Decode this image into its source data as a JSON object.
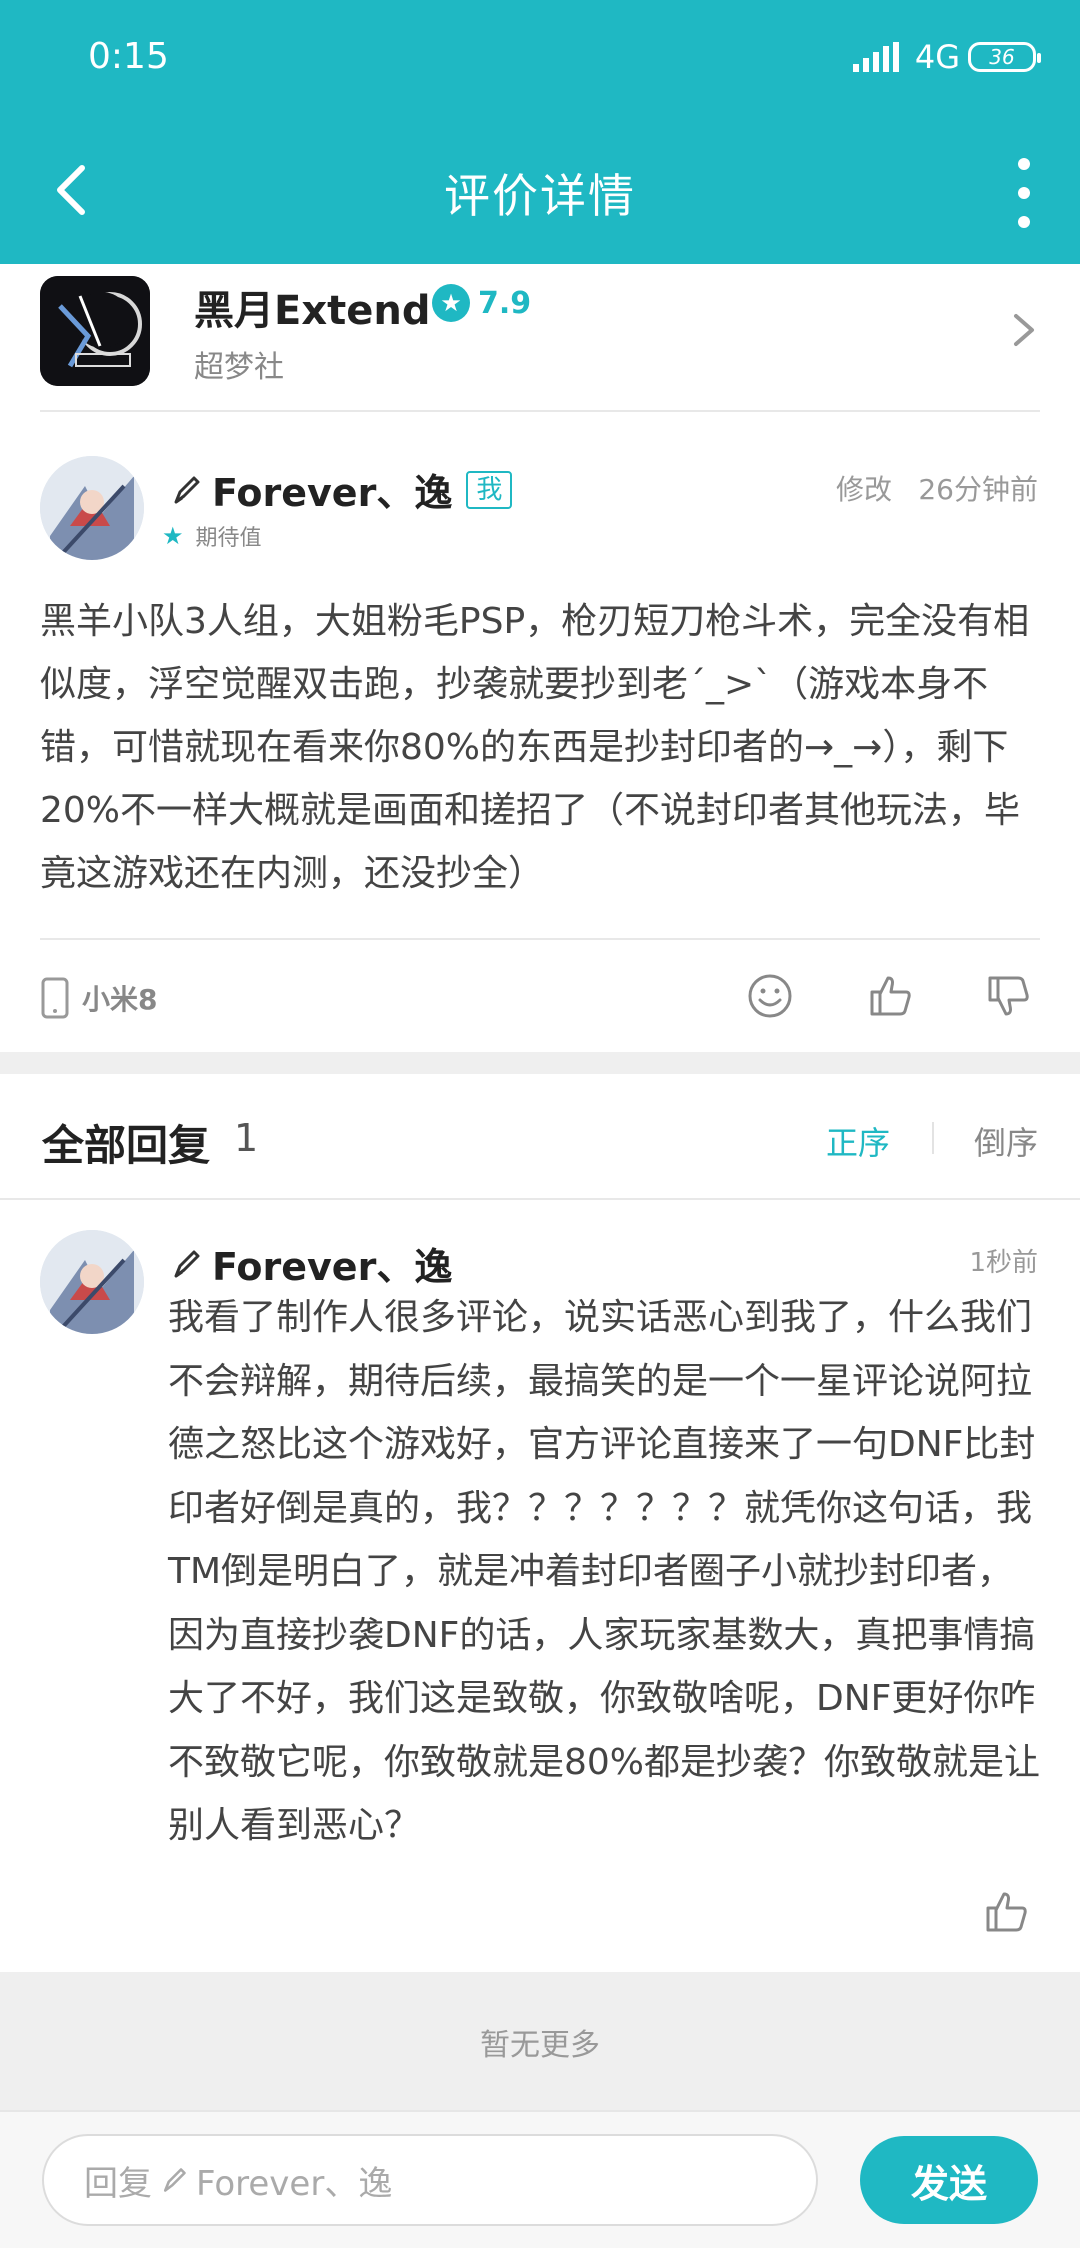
{
  "status": {
    "time": "0:15",
    "network": "4G",
    "battery": "36"
  },
  "header": {
    "title": "评价详情",
    "back_icon": "back-arrow-icon",
    "more_icon": "more-vertical-icon"
  },
  "game": {
    "name": "黑月Extend",
    "rating": "7.9",
    "publisher": "超梦社",
    "colors": {
      "accent": "#1fb8c3"
    }
  },
  "review": {
    "user": "Forever、逸",
    "badge": "我",
    "edit_label": "修改",
    "time": "26分钟前",
    "expect_label": "期待值",
    "body": "黑羊小队3人组，大姐粉毛PSP，枪刃短刀枪斗术，完全没有相似度，浮空觉醒双击跑，抄袭就要抄到老´_>`（游戏本身不错，可惜就现在看来你80%的东西是抄封印者的→_→），剩下20%不一样大概就是画面和搓招了（不说封印者其他玩法，毕竟这游戏还在内测，还没抄全）",
    "device": "小米8"
  },
  "replies": {
    "title": "全部回复",
    "count": "1",
    "sort_asc": "正序",
    "sort_desc": "倒序",
    "items": [
      {
        "user": "Forever、逸",
        "time": "1秒前",
        "body": "我看了制作人很多评论，说实话恶心到我了，什么我们不会辩解，期待后续，最搞笑的是一个一星评论说阿拉德之怒比这个游戏好，官方评论直接来了一句DNF比封印者好倒是真的，我？？？？？？？就凭你这句话，我TM倒是明白了，就是冲着封印者圈子小就抄封印者，因为直接抄袭DNF的话，人家玩家基数大，真把事情搞大了不好，我们这是致敬，你致敬啥呢，DNF更好你咋不致敬它呢，你致敬就是80%都是抄袭？你致敬就是让别人看到恶心？"
      }
    ]
  },
  "footer": {
    "no_more": "暂无更多",
    "reply_prefix": "回复",
    "reply_target": "Forever、逸",
    "send_label": "发送"
  }
}
